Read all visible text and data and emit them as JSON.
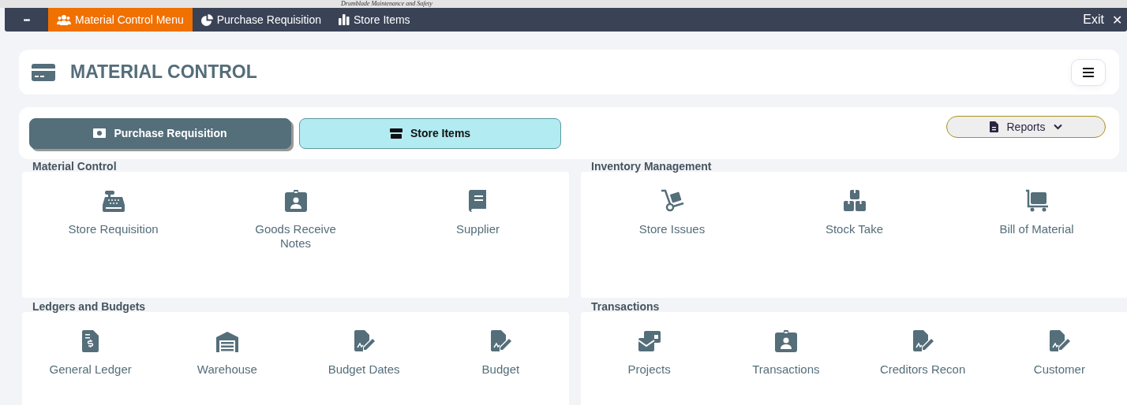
{
  "caption": "Drumblade Maintenance and Safety",
  "nav": {
    "more": "•••",
    "items": [
      {
        "label": "Material Control Menu",
        "selected": true
      },
      {
        "label": "Purchase Requisition",
        "selected": false
      },
      {
        "label": "Store Items",
        "selected": false
      }
    ],
    "exit": "Exit",
    "close": "✕"
  },
  "header": {
    "title": "MATERIAL CONTROL"
  },
  "actions": [
    {
      "label": "Purchase Requisition",
      "selected": true
    },
    {
      "label": "Store Items",
      "selected": false
    }
  ],
  "reports": "Reports",
  "sections": [
    {
      "title": "Material Control",
      "tiles": [
        {
          "label": "Store Requisition"
        },
        {
          "label": "Goods Receive Notes"
        },
        {
          "label": "Supplier"
        }
      ]
    },
    {
      "title": "Inventory Management",
      "tiles": [
        {
          "label": "Store Issues"
        },
        {
          "label": "Stock Take"
        },
        {
          "label": "Bill of Material"
        }
      ]
    },
    {
      "title": "Ledgers and Budgets",
      "tiles": [
        {
          "label": "General Ledger"
        },
        {
          "label": "Warehouse"
        },
        {
          "label": "Budget Dates"
        },
        {
          "label": "Budget"
        }
      ]
    },
    {
      "title": "Transactions",
      "tiles": [
        {
          "label": "Projects"
        },
        {
          "label": "Transactions"
        },
        {
          "label": "Creditors Recon"
        },
        {
          "label": "Customer"
        }
      ]
    }
  ]
}
